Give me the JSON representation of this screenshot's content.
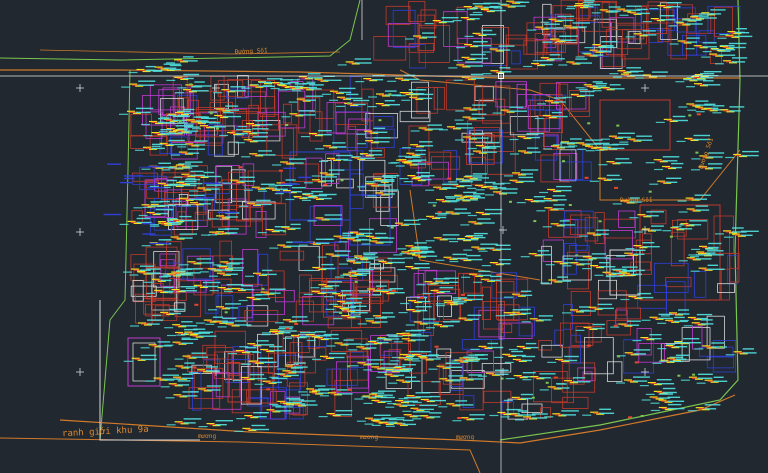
{
  "drawing": {
    "boundary_label": "ranh giới khu 9a",
    "road_labels": [
      "mương",
      "mương",
      "mương",
      "Đường Số1",
      "Đường Số1",
      "Đường Số1"
    ],
    "colors": {
      "background": "#212830",
      "parcel_red": "#c0392b",
      "parcel_magenta": "#c03ad0",
      "parcel_blue": "#2f3fd8",
      "parcel_white": "#d8d8d8",
      "road_orange": "#d07a2a",
      "boundary_green": "#7ac74f",
      "annotation_cyan": "#4fe3e0",
      "marker_yellow": "#f2e21c",
      "marker_red": "#e8452c"
    }
  }
}
